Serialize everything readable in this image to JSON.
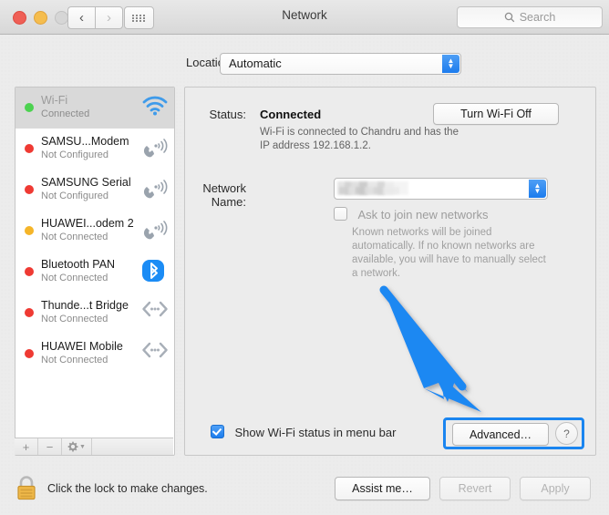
{
  "window": {
    "title": "Network",
    "traffic_lights": [
      "close",
      "minimize",
      "zoom-disabled"
    ],
    "nav_back": "‹",
    "nav_forward": "›",
    "grid_button": "show-all-icon"
  },
  "search": {
    "placeholder": "Search",
    "icon": "search-icon"
  },
  "location": {
    "label": "Location:",
    "value": "Automatic",
    "options": [
      "Automatic"
    ]
  },
  "sidebar": {
    "services": [
      {
        "name": "Wi-Fi",
        "status": "Connected",
        "dot": "#4cd250",
        "icon": "wifi-icon",
        "selected": true
      },
      {
        "name": "SAMSU...Modem",
        "status": "Not Configured",
        "dot": "#ef3a33",
        "icon": "modem-icon",
        "selected": false
      },
      {
        "name": "SAMSUNG Serial",
        "status": "Not Configured",
        "dot": "#ef3a33",
        "icon": "modem-icon",
        "selected": false
      },
      {
        "name": "HUAWEI...odem 2",
        "status": "Not Connected",
        "dot": "#f5b529",
        "icon": "modem-icon",
        "selected": false
      },
      {
        "name": "Bluetooth PAN",
        "status": "Not Connected",
        "dot": "#ef3a33",
        "icon": "bluetooth-icon",
        "selected": false
      },
      {
        "name": "Thunde...t Bridge",
        "status": "Not Connected",
        "dot": "#ef3a33",
        "icon": "bridge-icon",
        "selected": false
      },
      {
        "name": "HUAWEI Mobile",
        "status": "Not Connected",
        "dot": "#ef3a33",
        "icon": "bridge-icon",
        "selected": false
      }
    ],
    "add_label": "+",
    "remove_label": "−",
    "action_label": "gear-icon"
  },
  "main": {
    "status_label": "Status:",
    "status_value": "Connected",
    "status_description": "Wi-Fi is connected to Chandru and has the IP address 192.168.1.2.",
    "turn_off_label": "Turn Wi-Fi Off",
    "network_name_label": "Network Name:",
    "network_name_value": "",
    "ask_join_label": "Ask to join new networks",
    "ask_join_checked": false,
    "ask_join_help": "Known networks will be joined automatically. If no known networks are available, you will have to manually select a network.",
    "show_status_label": "Show Wi-Fi status in menu bar",
    "show_status_checked": true,
    "advanced_label": "Advanced…",
    "help_label": "?"
  },
  "footer": {
    "lock_icon": "lock-closed-icon",
    "lock_text": "Click the lock to make changes.",
    "assist_label": "Assist me…",
    "revert_label": "Revert",
    "apply_label": "Apply"
  },
  "annotation": {
    "type": "arrow",
    "color": "#1a86f2",
    "points_to": "Advanced…",
    "highlight_color": "#1a85f0"
  }
}
